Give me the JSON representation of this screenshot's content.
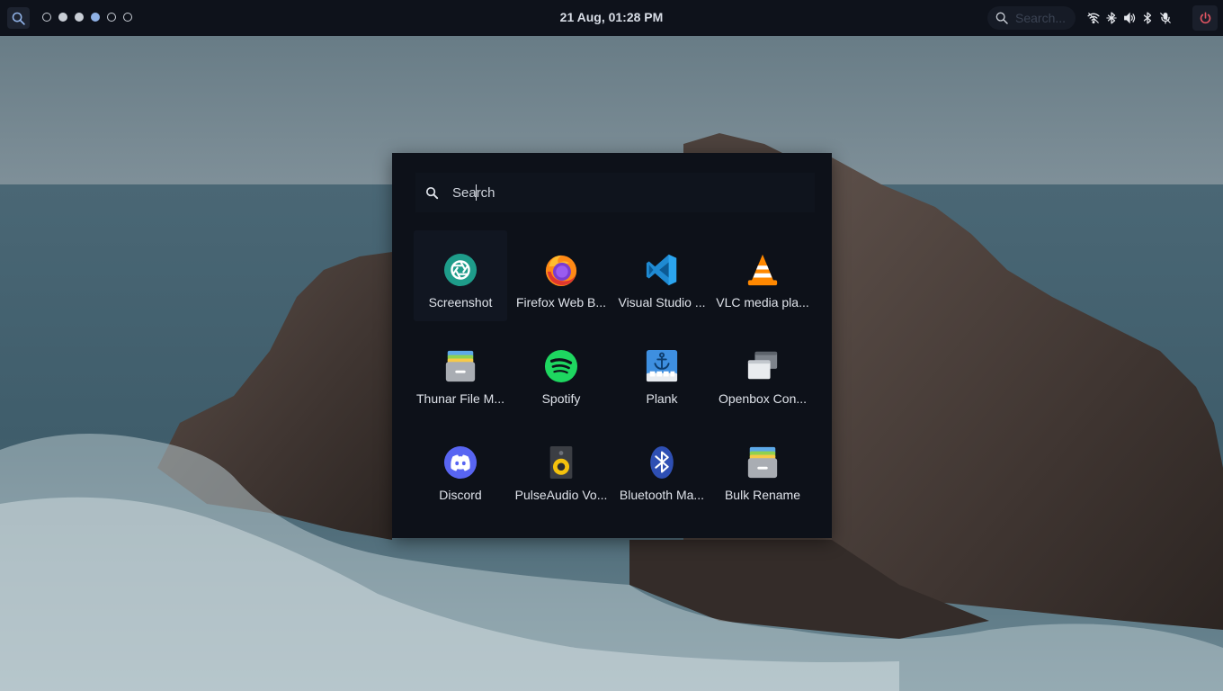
{
  "topbar": {
    "clock": "21 Aug, 01:28 PM",
    "search_placeholder": "Search...",
    "workspaces": [
      {
        "state": "empty"
      },
      {
        "state": "filled"
      },
      {
        "state": "filled"
      },
      {
        "state": "active"
      },
      {
        "state": "empty"
      },
      {
        "state": "empty"
      }
    ],
    "tray_icons": [
      "wifi-icon",
      "bluetooth-off-icon",
      "volume-icon",
      "bluetooth-icon",
      "microphone-muted-icon"
    ],
    "power_icon": "power-icon",
    "colors": {
      "bar_bg": "#0e121b",
      "power_accent": "#e25563",
      "active_workspace": "#8fb1e6"
    }
  },
  "launcher": {
    "search_placeholder": "Search",
    "apps": [
      {
        "label": "Screenshot",
        "icon": "screenshot-icon"
      },
      {
        "label": "Firefox Web B...",
        "icon": "firefox-icon"
      },
      {
        "label": "Visual Studio ...",
        "icon": "vscode-icon"
      },
      {
        "label": "VLC media pla...",
        "icon": "vlc-icon"
      },
      {
        "label": "Thunar File M...",
        "icon": "file-manager-icon"
      },
      {
        "label": "Spotify",
        "icon": "spotify-icon"
      },
      {
        "label": "Plank",
        "icon": "plank-icon"
      },
      {
        "label": "Openbox Con...",
        "icon": "openbox-config-icon"
      },
      {
        "label": "Discord",
        "icon": "discord-icon"
      },
      {
        "label": "PulseAudio Vo...",
        "icon": "speaker-icon"
      },
      {
        "label": "Bluetooth Ma...",
        "icon": "bluetooth-manager-icon"
      },
      {
        "label": "Bulk Rename",
        "icon": "bulk-rename-icon"
      }
    ],
    "colors": {
      "panel_bg": "#0d1119"
    }
  }
}
